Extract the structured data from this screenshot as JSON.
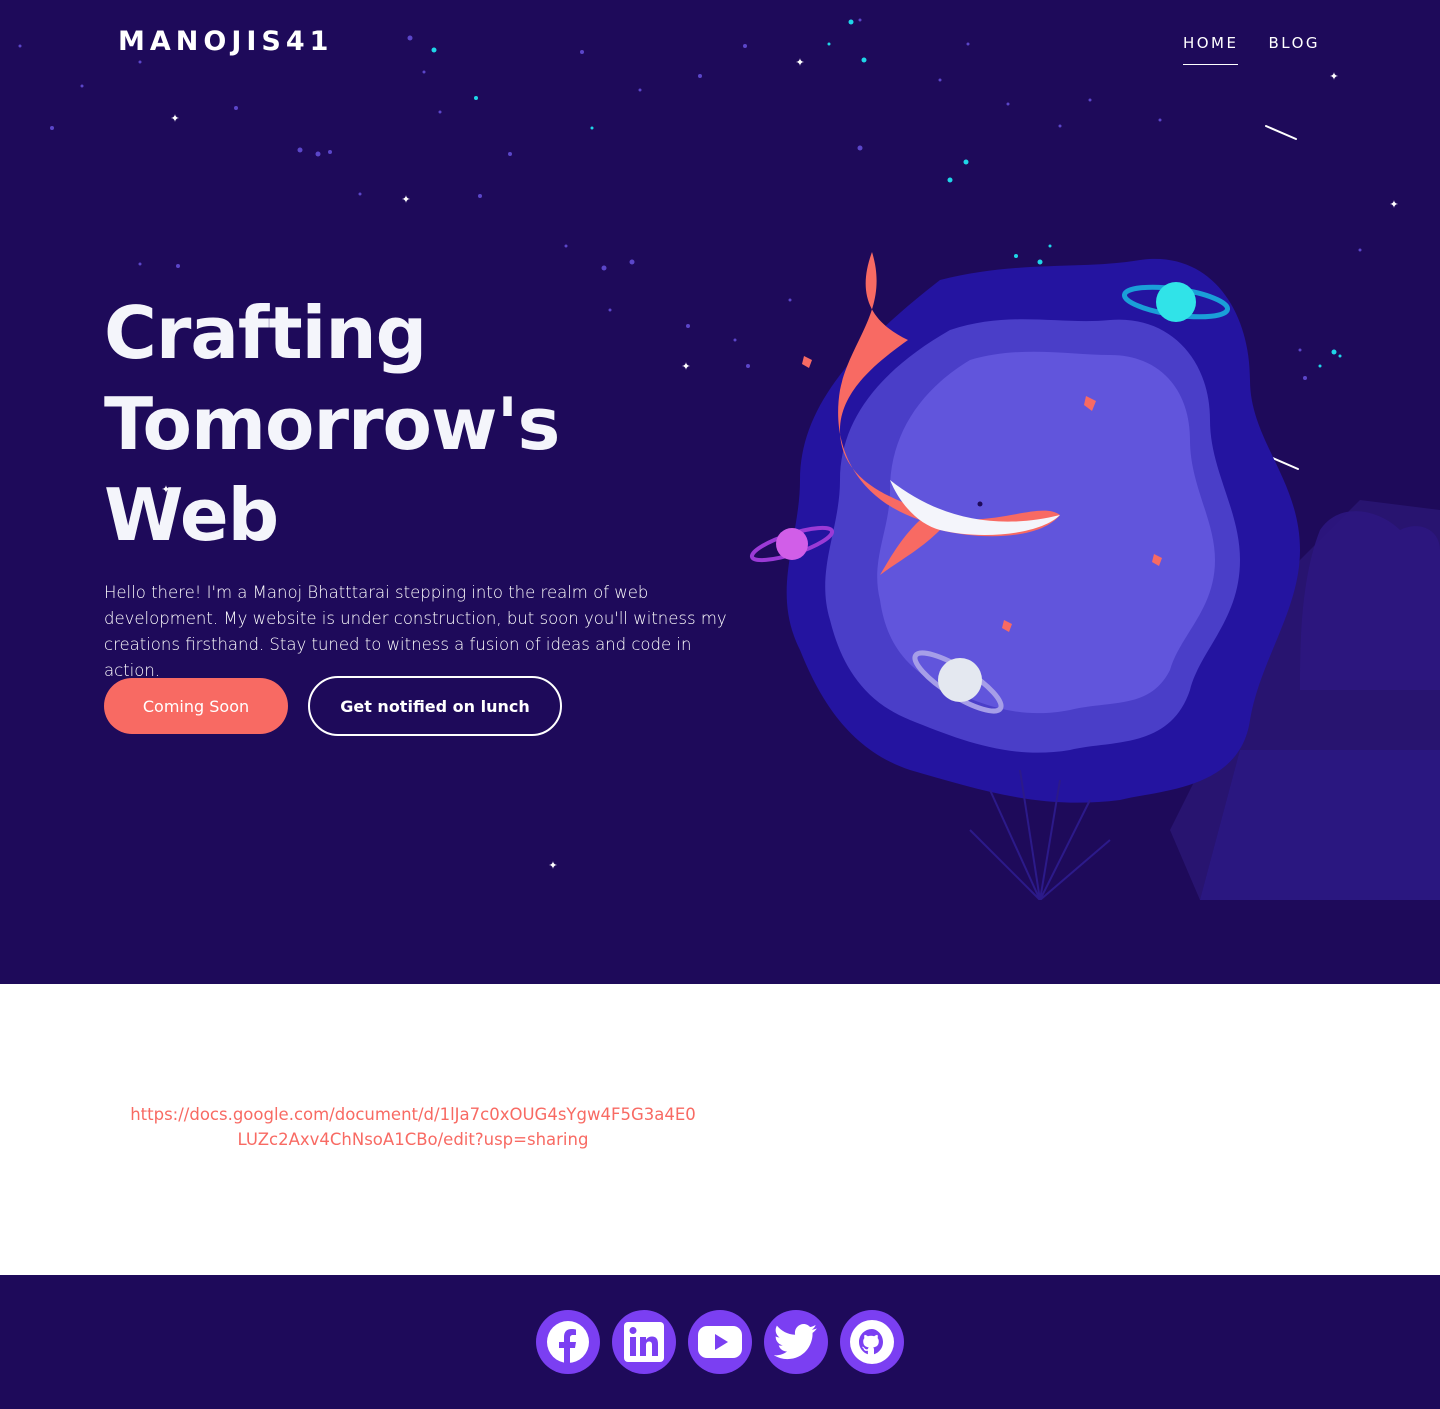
{
  "brand": {
    "logo_text": "MANOJIS41"
  },
  "nav": {
    "items": [
      {
        "label": "HOME",
        "active": true
      },
      {
        "label": "BLOG",
        "active": false
      }
    ]
  },
  "hero": {
    "headline_lines": [
      "Crafting",
      "Tomorrow's",
      "Web"
    ],
    "intro": "Hello there! I'm a Manoj Bhatttarai stepping into the realm of web development. My website is under construction, but soon you'll witness my creations firsthand. Stay tuned to witness a fusion of ideas and code in action.",
    "primary_button": "Coming Soon",
    "secondary_button": "Get notified on lunch"
  },
  "content": {
    "doc_link": "https://docs.google.com/document/d/1lJa7c0xOUG4sYgw4F5G3a4E0LUZc2Axv4ChNsoA1CBo/edit?usp=sharing"
  },
  "footer": {
    "socials": [
      {
        "name": "facebook",
        "icon": "facebook-icon"
      },
      {
        "name": "linkedin",
        "icon": "linkedin-icon"
      },
      {
        "name": "youtube",
        "icon": "youtube-icon"
      },
      {
        "name": "twitter",
        "icon": "twitter-icon"
      },
      {
        "name": "github",
        "icon": "github-icon"
      }
    ]
  },
  "colors": {
    "hero_bg": "#1e0a5a",
    "accent_coral": "#f86a63",
    "social_purple": "#7b3ff2",
    "blob_outer": "#2414a0",
    "blob_inner": "#6155dc"
  }
}
